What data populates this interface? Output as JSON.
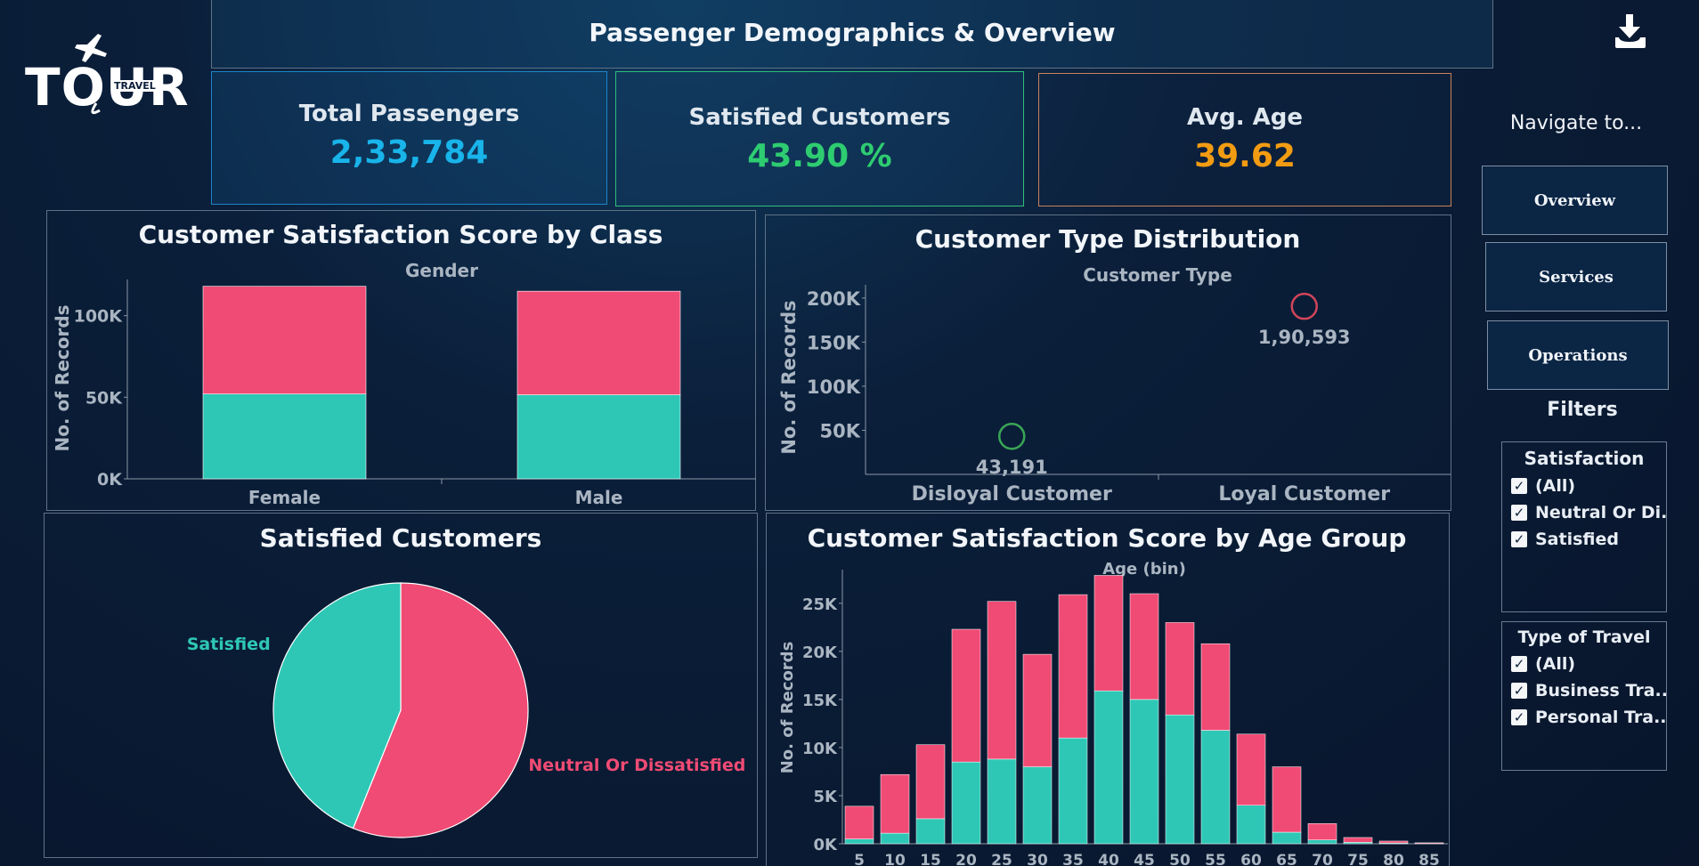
{
  "header": {
    "title": "Passenger Demographics & Overview",
    "logo_main": "TOUR",
    "logo_sub": "TRAVEL"
  },
  "kpis": [
    {
      "label": "Total Passengers",
      "value": "2,33,784",
      "color": "#18b4ea"
    },
    {
      "label": "Satisfied Customers",
      "value": "43.90 %",
      "color": "#2ecc71"
    },
    {
      "label": "Avg. Age",
      "value": "39.62",
      "color": "#f39c12"
    }
  ],
  "nav": {
    "title": "Navigate to...",
    "buttons": [
      "Overview",
      "Services",
      "Operations"
    ]
  },
  "filters": {
    "title": "Filters",
    "satisfaction": {
      "title": "Satisfaction",
      "options": [
        "(All)",
        "Neutral Or Di...",
        "Satisfied"
      ]
    },
    "travel": {
      "title": "Type of Travel",
      "options": [
        "(All)",
        "Business Tra...",
        "Personal Tra..."
      ]
    }
  },
  "colors": {
    "teal": "#2ec7b6",
    "pink": "#f04b74"
  },
  "chart_data": [
    {
      "id": "class",
      "type": "bar",
      "title": "Customer Satisfaction Score by Class",
      "header": "Gender",
      "ylabel": "No. of Records",
      "categories": [
        "Female",
        "Male"
      ],
      "series": [
        {
          "values": [
            52000,
            51500
          ]
        },
        {
          "values": [
            66000,
            63500
          ]
        }
      ],
      "ylim": [
        0,
        120000
      ],
      "yticks": [
        {
          "v": 0,
          "label": "0K"
        },
        {
          "v": 50000,
          "label": "50K"
        },
        {
          "v": 100000,
          "label": "100K"
        }
      ]
    },
    {
      "id": "ctype",
      "type": "scatter",
      "title": "Customer Type Distribution",
      "header": "Customer Type",
      "ylabel": "No. of Records",
      "categories": [
        "Disloyal Customer",
        "Loyal Customer"
      ],
      "values": [
        43191,
        190593
      ],
      "data_labels": [
        "43,191",
        "1,90,593"
      ],
      "point_colors": [
        "#3aa655",
        "#d2455a"
      ],
      "ylim": [
        0,
        215000
      ],
      "yticks": [
        {
          "v": 50000,
          "label": "50K"
        },
        {
          "v": 100000,
          "label": "100K"
        },
        {
          "v": 150000,
          "label": "150K"
        },
        {
          "v": 200000,
          "label": "200K"
        }
      ]
    },
    {
      "id": "pie",
      "type": "pie",
      "title": "Satisfied Customers",
      "slices": [
        {
          "name": "Neutral Or Dissatisfied",
          "value": 56.1
        },
        {
          "name": "Satisfied",
          "value": 43.9
        }
      ]
    },
    {
      "id": "age",
      "type": "bar",
      "title": "Customer Satisfaction Score by Age Group",
      "header": "Age (bin)",
      "ylabel": "No. of Records",
      "categories": [
        "5",
        "10",
        "15",
        "20",
        "25",
        "30",
        "35",
        "40",
        "45",
        "50",
        "55",
        "60",
        "65",
        "70",
        "75",
        "80",
        "85"
      ],
      "series": [
        {
          "values": [
            500,
            1100,
            2600,
            8500,
            8800,
            8000,
            11000,
            15900,
            15000,
            13400,
            11800,
            4000,
            1200,
            400,
            150,
            80,
            20
          ]
        },
        {
          "values": [
            3400,
            6100,
            7700,
            13800,
            16400,
            11700,
            14900,
            12000,
            11000,
            9600,
            9000,
            7400,
            6800,
            1700,
            500,
            200,
            80
          ]
        }
      ],
      "ylim": [
        0,
        28500
      ],
      "yticks": [
        {
          "v": 0,
          "label": "0K"
        },
        {
          "v": 5000,
          "label": "5K"
        },
        {
          "v": 10000,
          "label": "10K"
        },
        {
          "v": 15000,
          "label": "15K"
        },
        {
          "v": 20000,
          "label": "20K"
        },
        {
          "v": 25000,
          "label": "25K"
        }
      ]
    }
  ]
}
